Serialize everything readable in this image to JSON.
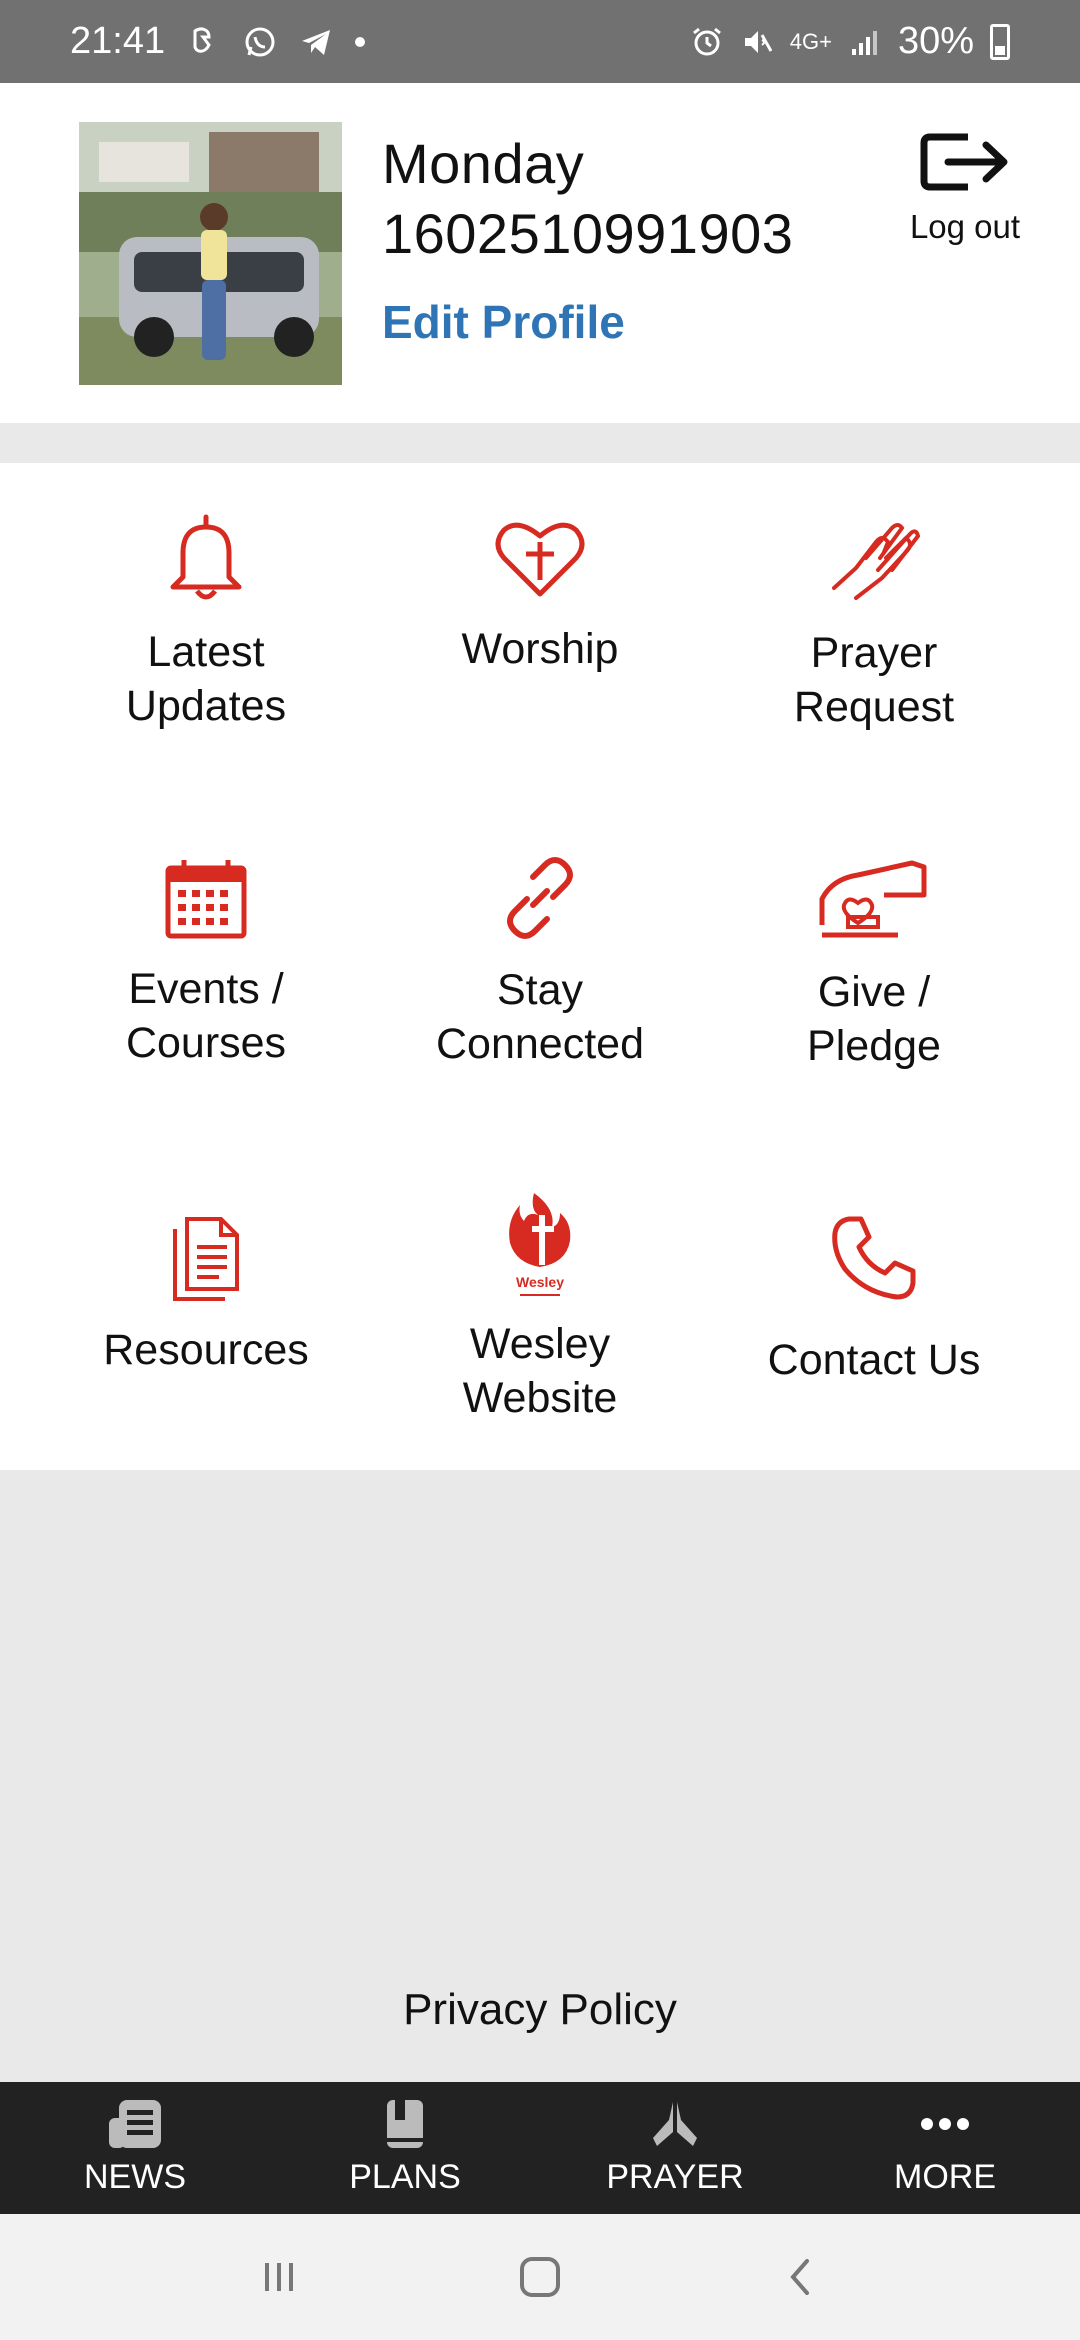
{
  "status_bar": {
    "time": "21:41",
    "network": "4G+",
    "battery": "30%"
  },
  "profile": {
    "name_line1": "Monday",
    "name_line2": "1602510991903",
    "edit_label": "Edit Profile",
    "logout_label": "Log out"
  },
  "grid": {
    "items": [
      {
        "label1": "Latest",
        "label2": "Updates",
        "icon": "bell-icon"
      },
      {
        "label1": "Worship",
        "label2": "",
        "icon": "heart-cross-icon"
      },
      {
        "label1": "Prayer",
        "label2": "Request",
        "icon": "praying-hands-icon"
      },
      {
        "label1": "Events /",
        "label2": "Courses",
        "icon": "calendar-icon"
      },
      {
        "label1": "Stay",
        "label2": "Connected",
        "icon": "link-icon"
      },
      {
        "label1": "Give /",
        "label2": "Pledge",
        "icon": "giving-hand-icon"
      },
      {
        "label1": "Resources",
        "label2": "",
        "icon": "document-icon"
      },
      {
        "label1": "Wesley",
        "label2": "Website",
        "icon": "wesley-logo-icon"
      },
      {
        "label1": "Contact Us",
        "label2": "",
        "icon": "phone-icon"
      }
    ],
    "logo_text": "Wesley"
  },
  "privacy_label": "Privacy Policy",
  "bottom_nav": {
    "items": [
      {
        "label": "NEWS",
        "icon": "newspaper-icon"
      },
      {
        "label": "PLANS",
        "icon": "book-icon"
      },
      {
        "label": "PRAYER",
        "icon": "pray-icon"
      },
      {
        "label": "MORE",
        "icon": "more-dots-icon"
      }
    ]
  },
  "colors": {
    "accent": "#d72b21",
    "link": "#2f74b5",
    "nav_bg": "#222222",
    "page_bg": "#e9e9e9"
  }
}
